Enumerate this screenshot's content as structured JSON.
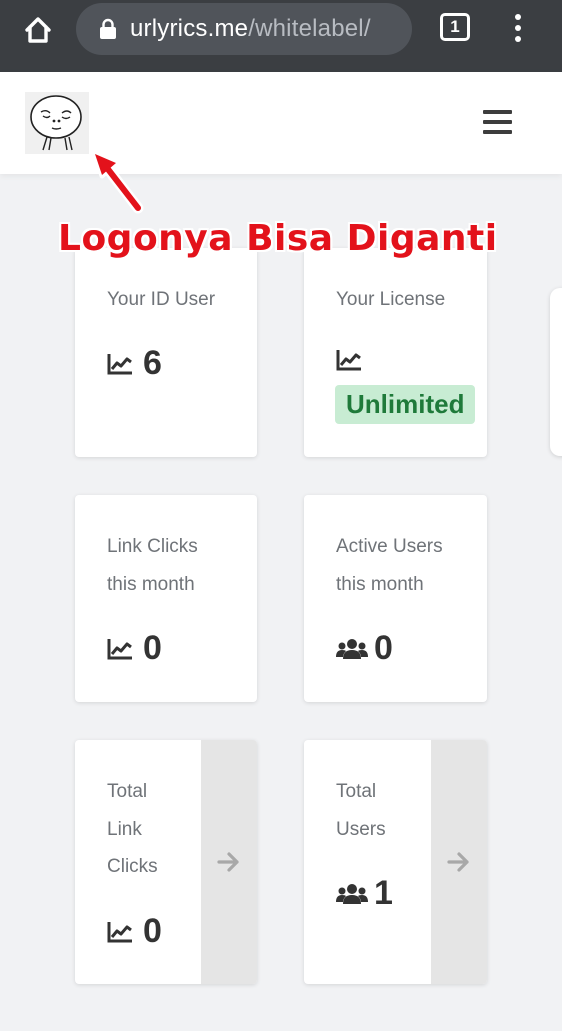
{
  "browser": {
    "url_host": "urlyrics.me",
    "url_path": "/whitelabel/",
    "tab_count": "1"
  },
  "annotation": {
    "text": "Logonya Bisa Diganti",
    "color": "#e3121b"
  },
  "cards": {
    "id_user": {
      "label": "Your ID User",
      "value": "6",
      "icon": "chart-line-icon"
    },
    "license": {
      "label": "Your License",
      "badge": "Unlimited",
      "icon": "chart-line-icon"
    },
    "link_clicks_month": {
      "label_line1": "Link Clicks",
      "label_line2": "this month",
      "value": "0",
      "icon": "chart-line-icon"
    },
    "active_users_month": {
      "label_line1": "Active Users",
      "label_line2": "this month",
      "value": "0",
      "icon": "users-icon"
    },
    "total_link_clicks": {
      "label_line1": "Total",
      "label_line2": "Link",
      "label_line3": "Clicks",
      "value": "0",
      "icon": "chart-line-icon",
      "action": "arrow-right-icon"
    },
    "total_users": {
      "label_line1": "Total",
      "label_line2": "Users",
      "value": "1",
      "icon": "users-icon",
      "action": "arrow-right-icon"
    }
  },
  "colors": {
    "chrome_bg": "#3b3e42",
    "page_bg": "#f1f2f4",
    "badge_bg": "#c8ecd3",
    "badge_text": "#1f7a3a"
  }
}
